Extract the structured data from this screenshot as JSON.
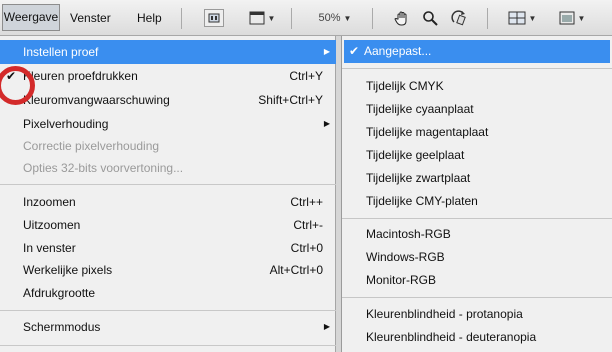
{
  "menubar": {
    "items": [
      "Weergave",
      "Venster",
      "Help"
    ],
    "zoom_level": "50%"
  },
  "main_menu": [
    {
      "label": "Instellen proef",
      "shortcut": "",
      "submenu": true,
      "highlighted": true
    },
    {
      "label": "Kleuren proefdrukken",
      "shortcut": "Ctrl+Y",
      "checked": true
    },
    {
      "label": "Kleuromvangwaarschuwing",
      "shortcut": "Shift+Ctrl+Y"
    },
    {
      "label": "Pixelverhouding",
      "shortcut": "",
      "submenu": true
    },
    {
      "label": "Correctie pixelverhouding",
      "shortcut": "",
      "disabled": true
    },
    {
      "label": "Opties 32-bits voorvertoning...",
      "shortcut": "",
      "disabled": true
    },
    {
      "label": "Inzoomen",
      "shortcut": "Ctrl++"
    },
    {
      "label": "Uitzoomen",
      "shortcut": "Ctrl+-"
    },
    {
      "label": "In venster",
      "shortcut": "Ctrl+0"
    },
    {
      "label": "Werkelijke pixels",
      "shortcut": "Alt+Ctrl+0"
    },
    {
      "label": "Afdrukgrootte",
      "shortcut": ""
    },
    {
      "label": "Schermmodus",
      "shortcut": "",
      "submenu": true
    }
  ],
  "sub_menu": [
    {
      "label": "Aangepast...",
      "checked": true,
      "highlighted": true
    },
    {
      "label": "Tijdelijk CMYK"
    },
    {
      "label": "Tijdelijke cyaanplaat"
    },
    {
      "label": "Tijdelijke magentaplaat"
    },
    {
      "label": "Tijdelijke geelplaat"
    },
    {
      "label": "Tijdelijke zwartplaat"
    },
    {
      "label": "Tijdelijke CMY-platen"
    },
    {
      "label": "Macintosh-RGB"
    },
    {
      "label": "Windows-RGB"
    },
    {
      "label": "Monitor-RGB"
    },
    {
      "label": "Kleurenblindheid - protanopia"
    },
    {
      "label": "Kleurenblindheid - deuteranopia"
    }
  ],
  "glyphs": {
    "check": "✔",
    "submenu_arrow": "▶",
    "chevron": "▼"
  },
  "colors": {
    "highlight": "#3a8eef",
    "annotation": "#d32a2a"
  }
}
